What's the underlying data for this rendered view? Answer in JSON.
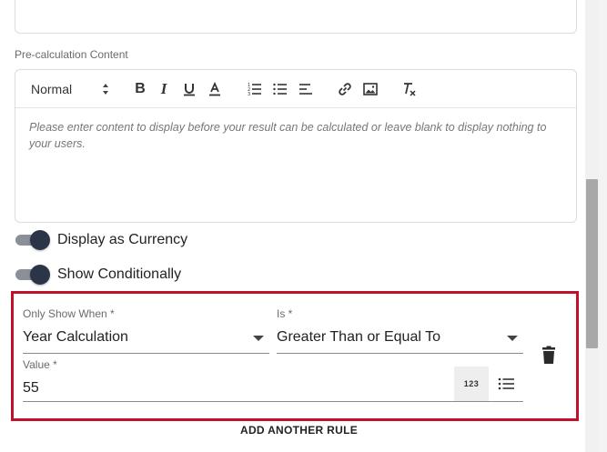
{
  "precalc": {
    "label": "Pre-calculation Content",
    "toolbar": {
      "format_value": "Normal",
      "bold": "B",
      "italic": "I"
    },
    "placeholder": "Please enter content to display before your result can be calculated or leave blank to display nothing to your users."
  },
  "toggles": {
    "currency": {
      "label": "Display as Currency",
      "on": true
    },
    "conditional": {
      "label": "Show Conditionally",
      "on": true
    }
  },
  "rule": {
    "only_show_when": {
      "label": "Only Show When *",
      "value": "Year Calculation"
    },
    "is": {
      "label": "Is *",
      "value": "Greater Than or Equal To"
    },
    "value": {
      "label": "Value *",
      "value": "55"
    },
    "number_mode": "123"
  },
  "add_rule_label": "ADD ANOTHER RULE",
  "colors": {
    "rule_border": "#c0102c",
    "toggle_thumb": "#2b3547",
    "toggle_track": "#8a8f99"
  }
}
